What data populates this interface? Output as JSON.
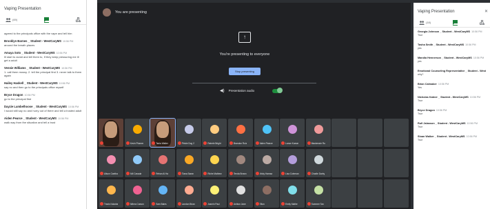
{
  "left_panel": {
    "title": "Vaping Presentation",
    "people_count": "(69)",
    "messages": [
      {
        "sender": "",
        "time": "",
        "text": "agreed to the principals office with the vape and tell him"
      },
      {
        "sender": "Brooklyn Barnes _ Student - WestCaryMS",
        "time": "10:56 PM",
        "text": "around the breath places"
      },
      {
        "sender": "Amaya Soto _ Student - WestCaryMS",
        "time": "10:56 PM",
        "text": "Ill start to avoid and tell them to, If they keep pressuring me ill get a adult"
      },
      {
        "sender": "Vennie Williams _ Student - WestCaryMS",
        "time": "10:56 PM",
        "text": "1. call them mossy. 2. tell the principal first 3. never talk to them again"
      },
      {
        "sender": "Hailey Haskell _ Student - WestCaryMS",
        "time": "10:56 PM",
        "text": "say no and then go to the principals office myself"
      },
      {
        "sender": "Bryce Dragon",
        "time": "10:56 PM",
        "text": "go to the principal first"
      },
      {
        "sender": "Dayzie Lambelhoose _ Student - WestCaryMS",
        "time": "10:56 PM",
        "text": "I would still say no and hurry out of there and tell a trusted adult"
      },
      {
        "sender": "Aiden Pearce _ Student - WestCaryMS",
        "time": "10:56 PM",
        "text": "walk way from the situation and tell a trust"
      }
    ]
  },
  "stage": {
    "presenting_label": "You are presenting",
    "present_message": "You're presenting to everyone",
    "stop_button": "Stop presenting",
    "audio_label": "Presentation audio",
    "participants": [
      {
        "name": "",
        "color": "#5d4037",
        "video": true
      },
      {
        "name": "Kevin Phamm",
        "color": "#f9ab00"
      },
      {
        "name": "Tania Walter",
        "color": "#5d4037",
        "video": true
      },
      {
        "name": "Pinkie Dog 2",
        "color": "#c5cae9"
      },
      {
        "name": "Rahele Bright",
        "color": "#ffcc80"
      },
      {
        "name": "Brandon Ruiz",
        "color": "#ff7043"
      },
      {
        "name": "Aiden Pearce",
        "color": "#4fc3f7"
      },
      {
        "name": "Lance Kumar",
        "color": "#ce93d8"
      },
      {
        "name": "Mackenzie Ru",
        "color": "#ef9a9a"
      },
      {
        "name": "",
        "color": "#3c4043"
      },
      {
        "name": "",
        "color": "#3c4043"
      },
      {
        "name": "",
        "color": "#3c4043"
      },
      {
        "name": "Alison Cantha",
        "color": "#f48fb1"
      },
      {
        "name": "AM Cavada",
        "color": "#90caf9"
      },
      {
        "name": "Rehan Al Ha",
        "color": "#e57373"
      },
      {
        "name": "Tiana Saran",
        "color": "#f9a825"
      },
      {
        "name": "Riche Mathew",
        "color": "#ffd54f"
      },
      {
        "name": "Tenda Brown",
        "color": "#a1887f"
      },
      {
        "name": "Vicky Hamsa",
        "color": "#bcaaa4"
      },
      {
        "name": "Lisa Coleman",
        "color": "#b39ddb"
      },
      {
        "name": "Charlie Darby",
        "color": "#cfd8dc"
      },
      {
        "name": "",
        "color": "#3c4043"
      },
      {
        "name": "",
        "color": "#3c4043"
      },
      {
        "name": "",
        "color": "#3c4043"
      },
      {
        "name": "Travis Kakaha",
        "color": "#ffb74d"
      },
      {
        "name": "Althea Carson",
        "color": "#f06292"
      },
      {
        "name": "Sam Bales",
        "color": "#64b5f6"
      },
      {
        "name": "Landon Brian",
        "color": "#ffab91"
      },
      {
        "name": "Jasmin Paul",
        "color": "#fff176"
      },
      {
        "name": "Ashton Jane",
        "color": "#e0e0e0"
      },
      {
        "name": "Elton",
        "color": "#8d6e63"
      },
      {
        "name": "Emily Mathe",
        "color": "#80deea"
      },
      {
        "name": "Summer Tan",
        "color": "#c5e1a5"
      },
      {
        "name": "",
        "color": "#3c4043"
      },
      {
        "name": "",
        "color": "#3c4043"
      },
      {
        "name": "",
        "color": "#3c4043"
      }
    ]
  },
  "right_panel": {
    "title": "Vaping Presentation",
    "people_count": "(18)",
    "messages": [
      {
        "sender": "Georgia Johnson _ Student - WestCaryMS",
        "time": "10:56 PM",
        "text": "True"
      },
      {
        "sender": "Tasha Smith _ Student - WestCaryMS",
        "time": "10:56 PM",
        "text": "yes"
      },
      {
        "sender": "Mandia Hennerson _ Student - WestCaryMS",
        "time": "10:56 PM",
        "text": "yes"
      },
      {
        "sender": "Emotional Counseling Representative _ Student - WestCaryMS",
        "time": "10:56 PM",
        "text": "why?"
      },
      {
        "sender": "Brian Calmaker",
        "time": "10:56 PM",
        "text": "Yes"
      },
      {
        "sender": "Nicholas Katner _ Student - WestCaryMS",
        "time": "10:56 PM",
        "text": "True"
      },
      {
        "sender": "Bryce Dragon",
        "time": "10:56 PM",
        "text": "True"
      },
      {
        "sender": "Rufi Jalasson _ Student - WestCaryMS",
        "time": "10:56 PM",
        "text": "True"
      },
      {
        "sender": "Sloan Walker _ Student - WestCaryMS",
        "time": "10:56 PM",
        "text": "True"
      }
    ]
  },
  "colors": {
    "accent_green": "#188038",
    "stage_bg": "#202124",
    "tile_bg": "#3c4043",
    "button_blue": "#8ab4f8"
  },
  "icons": [
    "people-icon",
    "chat-icon",
    "activities-icon",
    "screen-share-icon",
    "audio-icon",
    "mic-off-icon",
    "close-icon"
  ]
}
